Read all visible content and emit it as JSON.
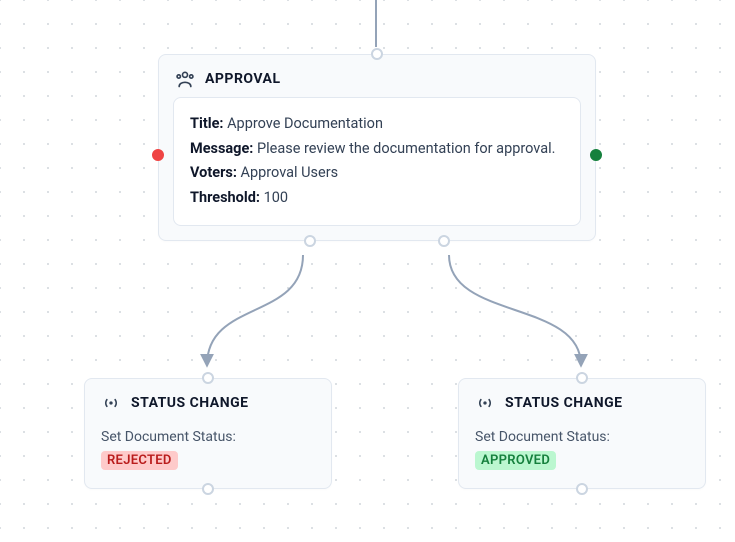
{
  "approval": {
    "header": "APPROVAL",
    "fields": {
      "title_label": "Title:",
      "title_value": "Approve Documentation",
      "message_label": "Message:",
      "message_value": "Please review the documentation for approval.",
      "voters_label": "Voters:",
      "voters_value": "Approval Users",
      "threshold_label": "Threshold:",
      "threshold_value": "100"
    }
  },
  "status_left": {
    "header": "STATUS CHANGE",
    "caption": "Set Document Status:",
    "badge": "REJECTED"
  },
  "status_right": {
    "header": "STATUS CHANGE",
    "caption": "Set Document Status:",
    "badge": "APPROVED"
  },
  "colors": {
    "reject_handle": "#ef4444",
    "approve_handle": "#15803d",
    "edge": "#94a3b8"
  }
}
